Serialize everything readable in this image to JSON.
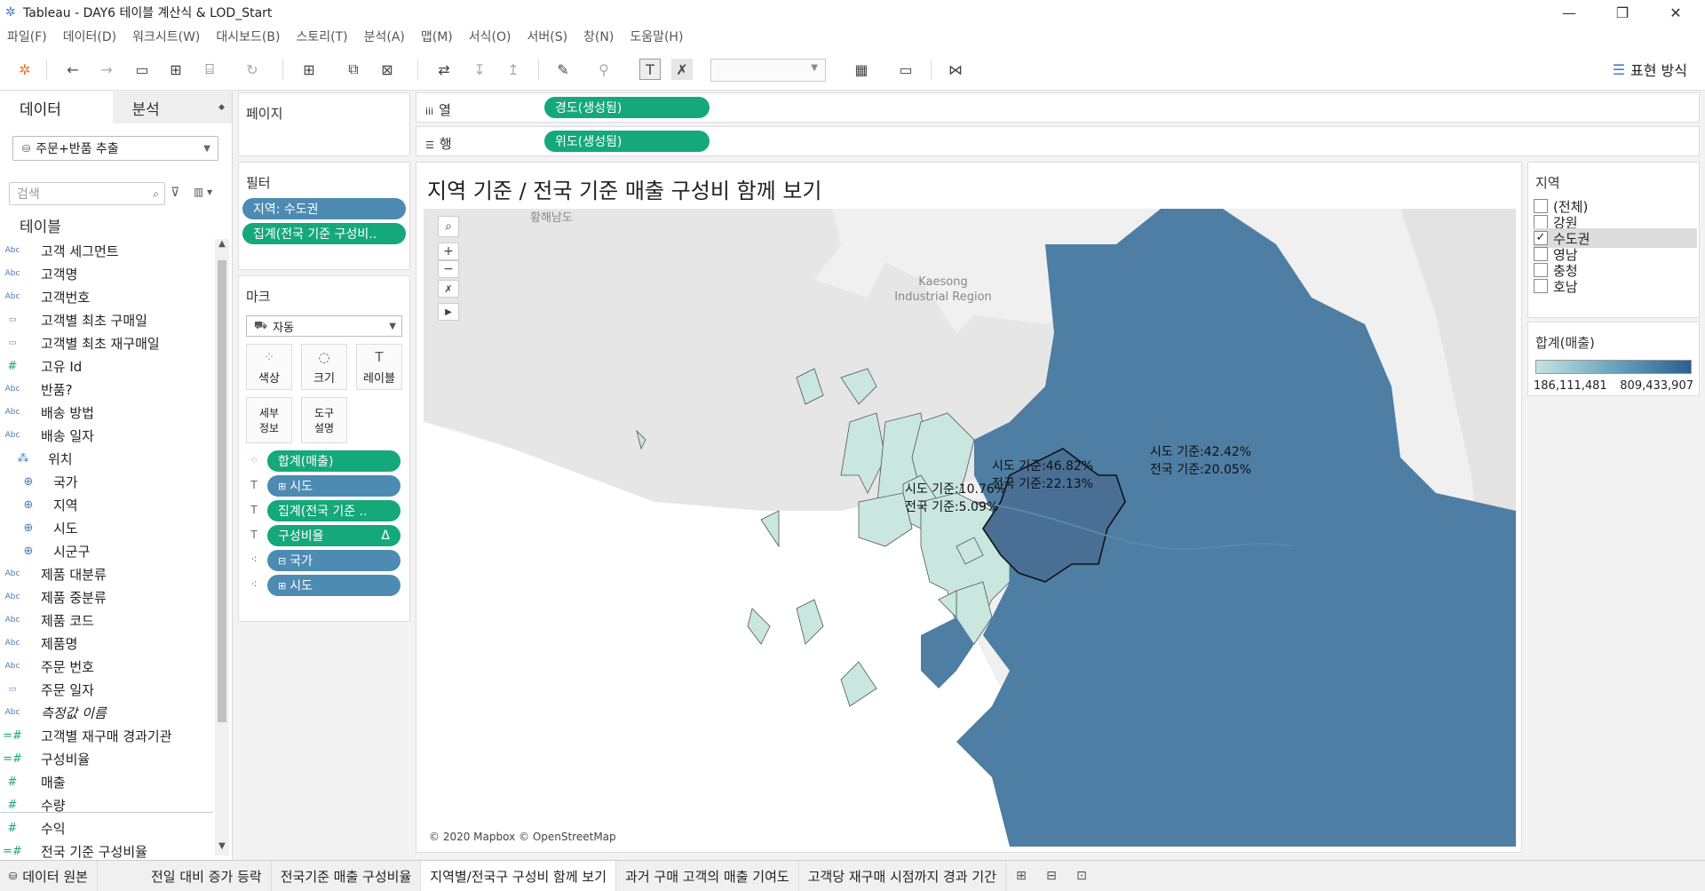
{
  "window": {
    "title": "Tableau - DAY6 테이블 계산식 & LOD_Start"
  },
  "menu": [
    "파일(F)",
    "데이터(D)",
    "워크시트(W)",
    "대시보드(B)",
    "스토리(T)",
    "분석(A)",
    "맵(M)",
    "서식(O)",
    "서버(S)",
    "창(N)",
    "도움말(H)"
  ],
  "toolbar": {
    "show_me": "표현 방식"
  },
  "data_pane": {
    "tab_data": "데이터",
    "tab_analytics": "분석",
    "datasource": "주문+반품 추출",
    "search_placeholder": "검색",
    "section": "테이블",
    "fields": [
      {
        "type": "Abc",
        "name": "고객 세그먼트"
      },
      {
        "type": "Abc",
        "name": "고객명"
      },
      {
        "type": "Abc",
        "name": "고객번호"
      },
      {
        "type": "date",
        "name": "고객별 최초 구매일"
      },
      {
        "type": "date",
        "name": "고객별 최초 재구매일"
      },
      {
        "type": "#",
        "name": "고유 Id"
      },
      {
        "type": "Abc",
        "name": "반품?"
      },
      {
        "type": "Abc",
        "name": "배송 방법"
      },
      {
        "type": "Abc",
        "name": "배송 일자"
      },
      {
        "type": "hier",
        "name": "위치"
      },
      {
        "type": "geo",
        "name": "국가"
      },
      {
        "type": "geo",
        "name": "지역"
      },
      {
        "type": "geo",
        "name": "시도"
      },
      {
        "type": "geo",
        "name": "시군구"
      },
      {
        "type": "Abc",
        "name": "제품 대분류"
      },
      {
        "type": "Abc",
        "name": "제품 중분류"
      },
      {
        "type": "Abc",
        "name": "제품 코드"
      },
      {
        "type": "Abc",
        "name": "제품명"
      },
      {
        "type": "Abc",
        "name": "주문 번호"
      },
      {
        "type": "date",
        "name": "주문 일자"
      },
      {
        "type": "Abc",
        "name": "측정값 이름"
      },
      {
        "type": "=#",
        "name": "고객별 재구매 경과기관"
      },
      {
        "type": "=#",
        "name": "구성비율"
      },
      {
        "type": "#",
        "name": "매출"
      },
      {
        "type": "#",
        "name": "수량"
      },
      {
        "type": "#",
        "name": "수익"
      },
      {
        "type": "=#",
        "name": "전국 기준 구성비율"
      }
    ]
  },
  "pages_card": {
    "title": "페이지"
  },
  "filters_card": {
    "title": "필터",
    "pills": [
      "지역: 수도권",
      "집계(전국 기준 구성비.."
    ]
  },
  "marks_card": {
    "title": "마크",
    "mark_type": "자동",
    "buttons": [
      "색상",
      "크기",
      "레이블",
      "세부 정보",
      "도구 설명"
    ],
    "pills": [
      "합계(매출)",
      "시도",
      "집계(전국 기준 ..",
      "구성비율",
      "국가",
      "시도"
    ]
  },
  "columns_shelf": {
    "label": "열",
    "pill": "경도(생성됨)"
  },
  "rows_shelf": {
    "label": "행",
    "pill": "위도(생성됨)"
  },
  "view": {
    "title": "지역 기준 / 전국 기준 매출 구성비 함께 보기",
    "map_labels": [
      "황해남도",
      "Kaesong Industrial Region"
    ],
    "attribution": "© 2020 Mapbox © OpenStreetMap",
    "mark_labels": [
      {
        "line1": "시도 기준:46.82%",
        "line2": "전국 기준:22.13%"
      },
      {
        "line1": "시도 기준:42.42%",
        "line2": "전국 기준:20.05%"
      },
      {
        "line1": "시도 기준:10.76%",
        "line2": "전국 기준:5.09%"
      }
    ]
  },
  "region_legend": {
    "title": "지역",
    "items": [
      {
        "label": "(전체)",
        "checked": false
      },
      {
        "label": "강원",
        "checked": false
      },
      {
        "label": "수도권",
        "checked": true
      },
      {
        "label": "영남",
        "checked": false
      },
      {
        "label": "충청",
        "checked": false
      },
      {
        "label": "호남",
        "checked": false
      }
    ]
  },
  "color_legend": {
    "title": "합계(매출)",
    "min": "186,111,481",
    "max": "809,433,907"
  },
  "tabs": {
    "datasource": "데이터 원본",
    "sheets": [
      "전일 대비 증가 등락",
      "전국기준 매출 구성비율",
      "지역별/전국구 구성비 함께 보기",
      "과거 구매 고객의 매출 기여도",
      "고객당 재구매 시점까지 경과 기간"
    ]
  },
  "colors": {
    "accent_green": "#15a87b",
    "dimension_blue": "#4d8bb3",
    "map_dark": "#4e7ea3",
    "map_light": "#c9e6df"
  }
}
